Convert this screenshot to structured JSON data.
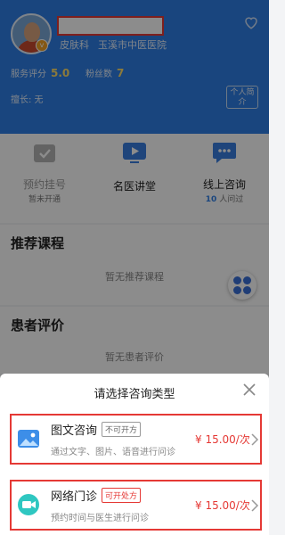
{
  "doctor": {
    "department": "皮肤科",
    "hospital": "玉溪市中医医院",
    "service_score_label": "服务评分",
    "service_score": "5.0",
    "fans_label": "粉丝数",
    "fans": "7",
    "specialty": "擅长: 无",
    "intro_button": "个人简介"
  },
  "services": [
    {
      "title": "预约挂号",
      "sub": "暂未开通",
      "icon": "calendar-check-icon",
      "disabled": true
    },
    {
      "title": "名医讲堂",
      "sub": "",
      "icon": "video-play-icon",
      "disabled": false
    },
    {
      "title": "线上咨询",
      "count": "10",
      "sub": "人问过",
      "icon": "chat-bubble-icon",
      "disabled": false
    }
  ],
  "courses": {
    "title": "推荐课程",
    "empty": "暂无推荐课程"
  },
  "reviews": {
    "title": "患者评价",
    "empty": "暂无患者评价"
  },
  "sheet": {
    "title": "请选择咨询类型",
    "options": [
      {
        "title": "图文咨询",
        "tag": "不可开方",
        "desc": "通过文字、图片、语音进行问诊",
        "price": "¥ 15.00/次",
        "icon": "image-icon"
      },
      {
        "title": "网络门诊",
        "tag": "可开处方",
        "desc": "预约时间与医生进行问诊",
        "price": "¥ 15.00/次",
        "icon": "video-camera-icon"
      }
    ]
  },
  "colors": {
    "header": "#2f7fe5",
    "accent_red": "#e53935",
    "score": "#ffdf6b"
  }
}
